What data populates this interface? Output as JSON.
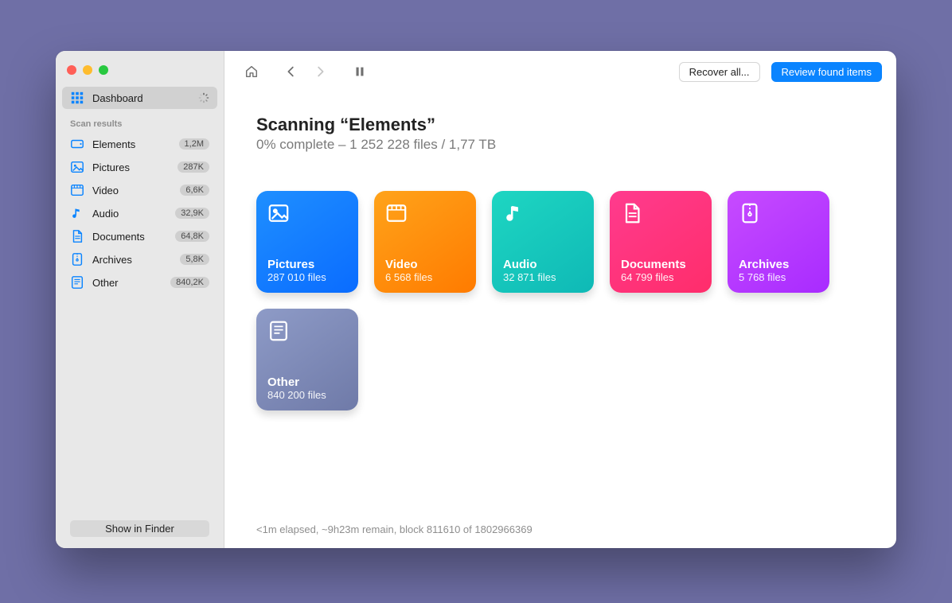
{
  "sidebar": {
    "dashboard_label": "Dashboard",
    "section_header": "Scan results",
    "items": [
      {
        "label": "Elements",
        "count": "1,2M",
        "icon": "drive"
      },
      {
        "label": "Pictures",
        "count": "287K",
        "icon": "picture"
      },
      {
        "label": "Video",
        "count": "6,6K",
        "icon": "video"
      },
      {
        "label": "Audio",
        "count": "32,9K",
        "icon": "audio"
      },
      {
        "label": "Documents",
        "count": "64,8K",
        "icon": "document"
      },
      {
        "label": "Archives",
        "count": "5,8K",
        "icon": "archive"
      },
      {
        "label": "Other",
        "count": "840,2K",
        "icon": "other"
      }
    ],
    "footer_button": "Show in Finder"
  },
  "toolbar": {
    "recover_label": "Recover all...",
    "review_label": "Review found items"
  },
  "main": {
    "title": "Scanning “Elements”",
    "subtitle": "0% complete – 1 252 228 files / 1,77 TB"
  },
  "cards": [
    {
      "title": "Pictures",
      "sub": "287 010 files",
      "icon": "picture",
      "bg": "linear-gradient(145deg,#1f8fff 0%,#0a6cff 100%)"
    },
    {
      "title": "Video",
      "sub": "6 568 files",
      "icon": "video",
      "bg": "linear-gradient(145deg,#ffa31a 0%,#ff7b00 100%)"
    },
    {
      "title": "Audio",
      "sub": "32 871 files",
      "icon": "audio",
      "bg": "linear-gradient(145deg,#1ed6c2 0%,#0fb9b6 100%)"
    },
    {
      "title": "Documents",
      "sub": "64 799 files",
      "icon": "document",
      "bg": "linear-gradient(145deg,#ff3b8e 0%,#ff2d6b 100%)"
    },
    {
      "title": "Archives",
      "sub": "5 768 files",
      "icon": "archive",
      "bg": "linear-gradient(145deg,#c74bff 0%,#a82bff 100%)"
    },
    {
      "title": "Other",
      "sub": "840 200 files",
      "icon": "other",
      "bg": "linear-gradient(145deg,#8e9bc7 0%,#6f7aa8 100%)"
    }
  ],
  "status": "<1m elapsed, ~9h23m remain, block 811610 of 1802966369"
}
